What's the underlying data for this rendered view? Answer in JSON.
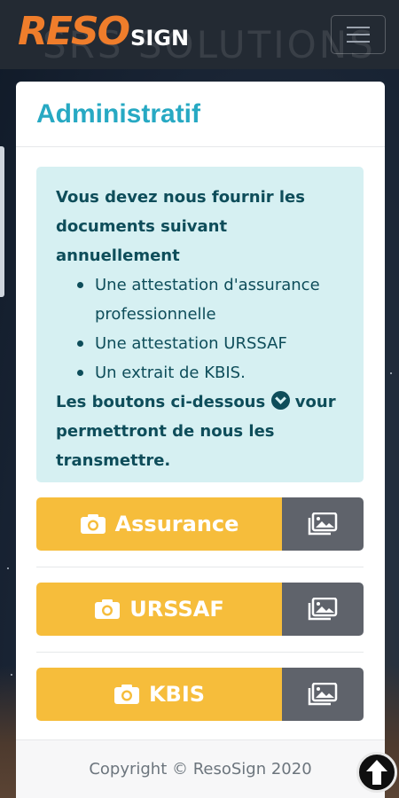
{
  "header": {
    "logo_reso": "RESO",
    "logo_sign": "SIGN",
    "watermark": "SRS SOLUTIONS",
    "menu_icon": "hamburger-menu-icon"
  },
  "card": {
    "title": "Administratif",
    "info": {
      "intro": "Vous devez nous fournir les documents suivant annuellement",
      "items": [
        "Une attestation d'assurance professionnelle",
        "Une attestation URSSAF",
        "Un extrait de KBIS."
      ],
      "outro_part1": "Les boutons ci-dessous",
      "outro_part2": "vour permettront de nous les transmettre."
    },
    "buttons": [
      {
        "label": "Assurance",
        "camera_icon": "camera-icon",
        "gallery_icon": "gallery-icon"
      },
      {
        "label": "URSSAF",
        "camera_icon": "camera-icon",
        "gallery_icon": "gallery-icon"
      },
      {
        "label": "KBIS",
        "camera_icon": "camera-icon",
        "gallery_icon": "gallery-icon"
      }
    ],
    "footer": "Copyright © ResoSign 2020"
  },
  "colors": {
    "accent": "#27a9c3",
    "info_bg": "#d6f0f2",
    "info_text": "#0e4d5a",
    "button_yellow": "#f6bd3b",
    "button_gray": "#5f636b",
    "logo_orange": "#ef7d2b"
  }
}
